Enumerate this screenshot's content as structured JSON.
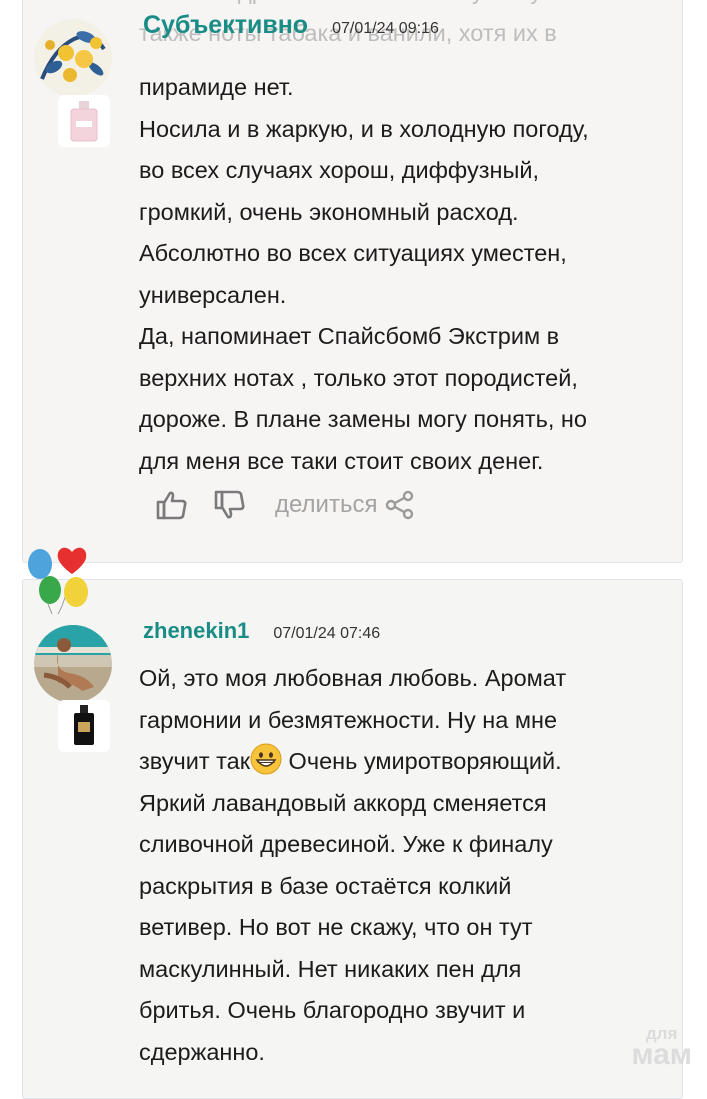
{
  "comments": [
    {
      "author": "Субъективно",
      "date": "07/01/24 09:16",
      "ghost_text": "с мягкой древесной базой. Я чувствую\nтакже ноты табака и ванили, хотя их в",
      "paragraphs": [
        "пирамиде нет.",
        "Носила и в жаркую, и в холодную погоду,\nво всех случаях хорош, диффузный,\nгромкий, очень экономный расход.\nАбсолютно во всех ситуациях уместен,\nуниверсален.",
        "Да, напоминает Спайсбомб Экстрим в\nверхних нотах , только этот породистей,\nдороже. В плане замены могу понять, но\nдля меня все таки стоит своих денег."
      ],
      "actions": {
        "like_icon": "thumbs-up-icon",
        "dislike_icon": "thumbs-down-icon",
        "share_label": "делиться",
        "share_icon": "share-icon"
      }
    },
    {
      "author": "zhenekin1",
      "date": "07/01/24 07:46",
      "text_before_emoji": "Ой, это моя любовная любовь. Аромат\nгармонии и безмятежности. Ну на мне\nзвучит так",
      "emoji_icon": "grinning-face-icon",
      "text_after_emoji": " Очень умиротворяющий.\nЯркий лавандовый аккорд сменяется\nсливочной древесиной. Уже к финалу\nраскрытия в базе остаётся колкий\nветивер. Но вот не скажу, что он тут\nмаскулинный. Нет никаких пен для\nбритья. Очень благородно звучит и\nсдержанно."
    }
  ],
  "watermark": {
    "top": "для",
    "main": "мам"
  },
  "colors": {
    "accent": "#1a8c86",
    "muted": "#a3a3a3",
    "card_bg": "#f7f5f4"
  }
}
